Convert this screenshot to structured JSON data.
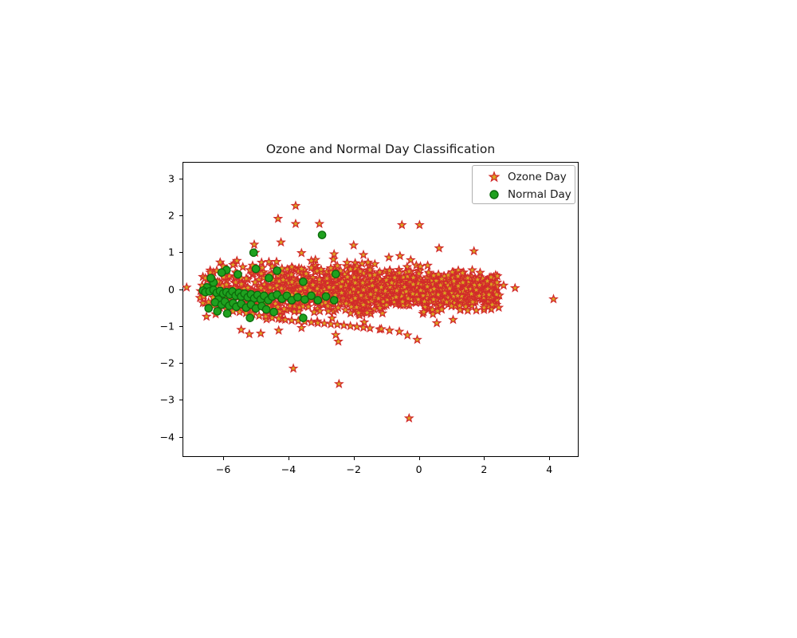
{
  "chart_data": {
    "type": "scatter",
    "title": "Ozone and Normal Day Classification",
    "xlabel": "",
    "ylabel": "",
    "xlim": [
      -7.25,
      4.9
    ],
    "ylim": [
      -4.55,
      3.45
    ],
    "xticks": [
      -6,
      -4,
      -2,
      0,
      2,
      4
    ],
    "xtick_labels": [
      "−6",
      "−4",
      "−2",
      "0",
      "2",
      "4"
    ],
    "yticks": [
      -4,
      -3,
      -2,
      -1,
      0,
      1,
      2,
      3
    ],
    "ytick_labels": [
      "−4",
      "−3",
      "−2",
      "−1",
      "0",
      "1",
      "2",
      "3"
    ],
    "grid": false,
    "legend_position": "upper right",
    "series": [
      {
        "name": "Ozone Day",
        "marker": "star",
        "color": "#DAA520",
        "edge_color": "#D22B2B",
        "size": 7.5,
        "count": 1680,
        "points": [
          [
            -3.78,
            2.26
          ],
          [
            -4.32,
            1.91
          ],
          [
            -3.05,
            1.77
          ],
          [
            -3.78,
            1.77
          ],
          [
            -0.52,
            1.74
          ],
          [
            0.02,
            1.74
          ],
          [
            -5.05,
            1.21
          ],
          [
            -4.23,
            1.27
          ],
          [
            -2.0,
            1.19
          ],
          [
            1.69,
            1.03
          ],
          [
            0.62,
            1.11
          ],
          [
            -5.02,
            0.99
          ],
          [
            -3.6,
            0.98
          ],
          [
            -2.6,
            0.95
          ],
          [
            -1.7,
            0.93
          ],
          [
            -0.58,
            0.9
          ],
          [
            -0.92,
            0.86
          ],
          [
            -0.25,
            0.79
          ],
          [
            -4.6,
            0.74
          ],
          [
            -3.3,
            0.77
          ],
          [
            -2.2,
            0.72
          ],
          [
            -1.35,
            0.68
          ],
          [
            0.27,
            0.64
          ],
          [
            -6.0,
            0.62
          ],
          [
            -5.7,
            0.66
          ],
          [
            -5.4,
            0.6
          ],
          [
            -5.1,
            0.64
          ],
          [
            -4.8,
            0.58
          ],
          [
            -4.5,
            0.62
          ],
          [
            -4.2,
            0.56
          ],
          [
            -3.9,
            0.6
          ],
          [
            -3.6,
            0.55
          ],
          [
            -3.3,
            0.58
          ],
          [
            -3.0,
            0.53
          ],
          [
            -2.7,
            0.57
          ],
          [
            -2.4,
            0.5
          ],
          [
            -2.1,
            0.54
          ],
          [
            -1.8,
            0.48
          ],
          [
            -1.5,
            0.52
          ],
          [
            -1.2,
            0.46
          ],
          [
            -0.9,
            0.5
          ],
          [
            -0.6,
            0.44
          ],
          [
            -0.3,
            0.48
          ],
          [
            0.0,
            0.42
          ],
          [
            0.3,
            0.45
          ],
          [
            0.6,
            0.4
          ],
          [
            0.9,
            0.38
          ],
          [
            1.2,
            0.35
          ],
          [
            1.5,
            0.3
          ],
          [
            1.8,
            0.26
          ],
          [
            2.1,
            0.22
          ],
          [
            2.4,
            0.18
          ],
          [
            2.6,
            0.1
          ],
          [
            2.95,
            0.03
          ],
          [
            4.13,
            -0.27
          ],
          [
            -6.4,
            0.45
          ],
          [
            -6.2,
            0.5
          ],
          [
            -6.55,
            0.3
          ],
          [
            -6.65,
            0.1
          ],
          [
            -6.7,
            -0.05
          ],
          [
            -6.6,
            -0.2
          ],
          [
            -6.45,
            -0.35
          ],
          [
            -6.3,
            -0.45
          ],
          [
            -6.1,
            -0.5
          ],
          [
            -5.9,
            -0.55
          ],
          [
            -5.7,
            -0.6
          ],
          [
            -5.5,
            -0.62
          ],
          [
            -5.3,
            -0.65
          ],
          [
            -5.1,
            -0.68
          ],
          [
            -4.9,
            -0.72
          ],
          [
            -4.7,
            -0.74
          ],
          [
            -4.5,
            -0.78
          ],
          [
            -4.3,
            -0.8
          ],
          [
            -4.1,
            -0.83
          ],
          [
            -3.9,
            -0.85
          ],
          [
            -3.7,
            -0.86
          ],
          [
            -3.5,
            -0.88
          ],
          [
            -3.3,
            -0.9
          ],
          [
            -3.1,
            -0.92
          ],
          [
            -2.9,
            -0.93
          ],
          [
            -2.7,
            -0.95
          ],
          [
            -2.5,
            -0.96
          ],
          [
            -2.3,
            -0.98
          ],
          [
            -2.1,
            -1.0
          ],
          [
            -1.9,
            -1.02
          ],
          [
            -1.7,
            -1.04
          ],
          [
            -1.5,
            -1.06
          ],
          [
            -1.2,
            -1.09
          ],
          [
            -0.9,
            -1.12
          ],
          [
            -0.6,
            -1.15
          ],
          [
            -0.35,
            -1.25
          ],
          [
            -0.05,
            -1.37
          ],
          [
            -2.47,
            -1.42
          ],
          [
            -2.55,
            -1.24
          ],
          [
            -1.15,
            -1.08
          ],
          [
            -5.2,
            -1.22
          ],
          [
            -4.85,
            -1.2
          ],
          [
            -5.45,
            -1.1
          ],
          [
            -4.3,
            -1.12
          ],
          [
            -3.6,
            -1.05
          ],
          [
            -3.85,
            -2.15
          ],
          [
            -2.45,
            -2.57
          ],
          [
            -0.3,
            -3.5
          ],
          [
            0.55,
            -0.92
          ],
          [
            1.05,
            -0.83
          ],
          [
            1.5,
            -0.58
          ],
          [
            2.0,
            -0.5
          ],
          [
            2.45,
            -0.5
          ],
          [
            1.25,
            -0.45
          ],
          [
            0.85,
            -0.35
          ],
          [
            0.45,
            -0.28
          ],
          [
            1.65,
            -0.35
          ],
          [
            2.25,
            -0.42
          ],
          [
            0.15,
            -0.62
          ],
          [
            0.7,
            -0.55
          ],
          [
            1.85,
            -0.18
          ],
          [
            1.35,
            0.18
          ]
        ],
        "cluster": {
          "description": "dense elongated cluster centered near x=-4.3, y=-0.05 spanning x -6.8 to 2.6, y -0.75 to 0.65",
          "n": 1560,
          "x_center": -4.3,
          "y_center": -0.05
        }
      },
      {
        "name": "Normal Day",
        "marker": "circle",
        "color": "#1FA11F",
        "edge_color": "#0B6B0B",
        "size": 9,
        "count": 64,
        "points": [
          [
            -2.97,
            1.47
          ],
          [
            -5.07,
            0.99
          ],
          [
            -5.9,
            0.52
          ],
          [
            -6.05,
            0.45
          ],
          [
            -5.55,
            0.4
          ],
          [
            -2.55,
            0.41
          ],
          [
            -3.55,
            0.2
          ],
          [
            -4.6,
            0.3
          ],
          [
            -6.3,
            0.18
          ],
          [
            -6.5,
            0.05
          ],
          [
            -6.62,
            -0.04
          ],
          [
            -6.55,
            -0.08
          ],
          [
            -6.42,
            -0.06
          ],
          [
            -6.3,
            -0.02
          ],
          [
            -6.2,
            -0.1
          ],
          [
            -6.1,
            -0.05
          ],
          [
            -6.0,
            -0.12
          ],
          [
            -5.9,
            -0.08
          ],
          [
            -5.8,
            -0.15
          ],
          [
            -5.72,
            -0.06
          ],
          [
            -5.62,
            -0.18
          ],
          [
            -5.52,
            -0.1
          ],
          [
            -5.45,
            -0.2
          ],
          [
            -5.35,
            -0.12
          ],
          [
            -5.25,
            -0.22
          ],
          [
            -5.15,
            -0.14
          ],
          [
            -5.05,
            -0.25
          ],
          [
            -4.95,
            -0.16
          ],
          [
            -4.85,
            -0.28
          ],
          [
            -4.75,
            -0.18
          ],
          [
            -4.62,
            -0.3
          ],
          [
            -4.5,
            -0.2
          ],
          [
            -4.35,
            -0.15
          ],
          [
            -4.2,
            -0.26
          ],
          [
            -4.05,
            -0.18
          ],
          [
            -3.9,
            -0.3
          ],
          [
            -3.72,
            -0.22
          ],
          [
            -3.5,
            -0.28
          ],
          [
            -3.3,
            -0.18
          ],
          [
            -3.1,
            -0.3
          ],
          [
            -2.85,
            -0.2
          ],
          [
            -2.6,
            -0.3
          ],
          [
            -6.15,
            -0.28
          ],
          [
            -6.25,
            -0.36
          ],
          [
            -6.05,
            -0.42
          ],
          [
            -5.95,
            -0.34
          ],
          [
            -5.82,
            -0.45
          ],
          [
            -5.7,
            -0.38
          ],
          [
            -5.6,
            -0.48
          ],
          [
            -5.45,
            -0.4
          ],
          [
            -5.3,
            -0.5
          ],
          [
            -5.15,
            -0.42
          ],
          [
            -5.0,
            -0.52
          ],
          [
            -4.82,
            -0.46
          ],
          [
            -4.68,
            -0.55
          ],
          [
            -5.18,
            -0.78
          ],
          [
            -3.55,
            -0.78
          ],
          [
            -6.38,
            0.3
          ],
          [
            -5.0,
            0.55
          ],
          [
            -4.35,
            0.5
          ],
          [
            -6.45,
            -0.52
          ],
          [
            -6.18,
            -0.6
          ],
          [
            -5.88,
            -0.66
          ],
          [
            -4.45,
            -0.62
          ]
        ]
      }
    ]
  },
  "legend": {
    "entries": [
      {
        "label": "Ozone Day",
        "marker": "star-marker",
        "color": "#DAA520"
      },
      {
        "label": "Normal Day",
        "marker": "circle-marker",
        "color": "#1FA11F"
      }
    ]
  }
}
